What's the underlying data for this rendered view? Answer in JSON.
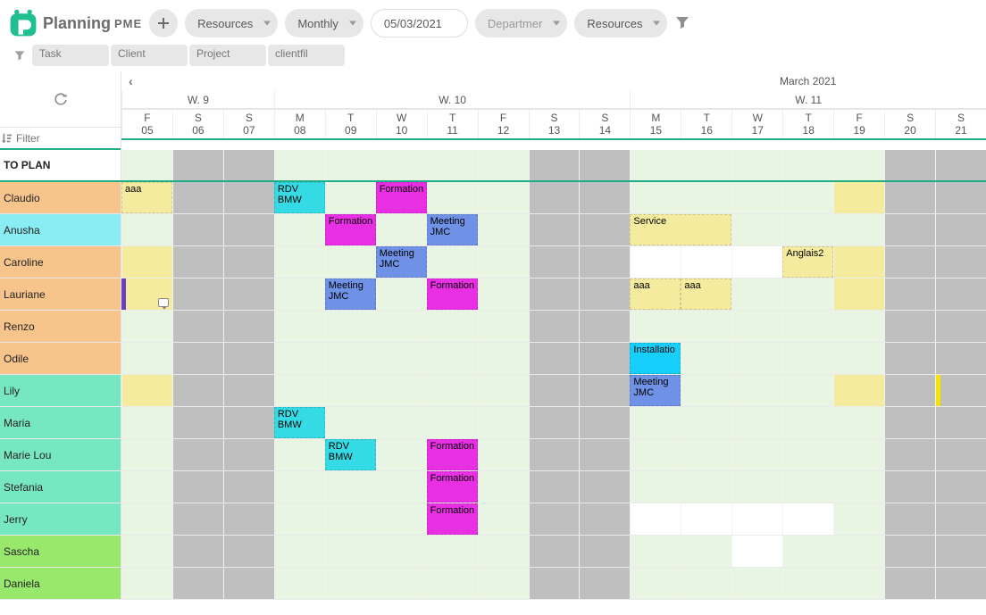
{
  "brand": {
    "name": "Planning",
    "suffix": "PME"
  },
  "toolbar": {
    "resources": "Resources",
    "view": "Monthly",
    "date": "05/03/2021",
    "department": "Departmer",
    "resources2": "Resources"
  },
  "filters": {
    "task": "Task",
    "client": "Client",
    "project": "Project",
    "clientfil": "clientfil"
  },
  "calendar": {
    "month_label": "March 2021",
    "weeks": [
      "W. 9",
      "W. 10",
      "W. 11"
    ],
    "days": [
      {
        "d": "F",
        "n": "05"
      },
      {
        "d": "S",
        "n": "06"
      },
      {
        "d": "S",
        "n": "07"
      },
      {
        "d": "M",
        "n": "08"
      },
      {
        "d": "T",
        "n": "09"
      },
      {
        "d": "W",
        "n": "10"
      },
      {
        "d": "T",
        "n": "11"
      },
      {
        "d": "F",
        "n": "12"
      },
      {
        "d": "S",
        "n": "13"
      },
      {
        "d": "S",
        "n": "14"
      },
      {
        "d": "M",
        "n": "15"
      },
      {
        "d": "T",
        "n": "16"
      },
      {
        "d": "W",
        "n": "17"
      },
      {
        "d": "T",
        "n": "18"
      },
      {
        "d": "F",
        "n": "19"
      },
      {
        "d": "S",
        "n": "20"
      },
      {
        "d": "S",
        "n": "21"
      }
    ],
    "filter_placeholder": "Filter"
  },
  "resources": [
    "TO PLAN",
    "Claudio",
    "Anusha",
    "Caroline",
    "Lauriane",
    "Renzo",
    "Odile",
    "Lily",
    "Maria",
    "Marie Lou",
    "Stefania",
    "Jerry",
    "Sascha",
    "Daniela"
  ],
  "events": {
    "claudio": {
      "aaa": "aaa",
      "rdv": "RDV BMW",
      "formation": "Formation"
    },
    "anusha": {
      "formation": "Formation",
      "meeting": "Meeting JMC",
      "service": "Service"
    },
    "caroline": {
      "meeting": "Meeting JMC",
      "anglais": "Anglais2"
    },
    "lauriane": {
      "meeting": "Meeting JMC",
      "formation": "Formation",
      "aaa1": "aaa",
      "aaa2": "aaa"
    },
    "odile": {
      "install": "Installatio"
    },
    "lily": {
      "meeting": "Meeting JMC"
    },
    "maria": {
      "rdv": "RDV BMW"
    },
    "marielou": {
      "rdv": "RDV BMW",
      "formation": "Formation"
    },
    "stefania": {
      "formation": "Formation"
    },
    "jerry": {
      "formation": "Formation"
    }
  }
}
